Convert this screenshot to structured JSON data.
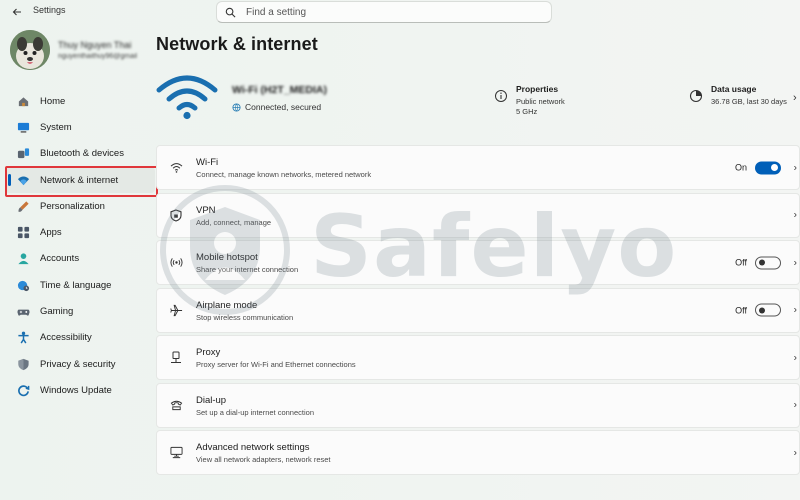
{
  "app": {
    "title": "Settings",
    "back_icon": "back-arrow-icon"
  },
  "search": {
    "placeholder": "Find a setting",
    "icon": "search-icon"
  },
  "profile": {
    "name": "Thuy Nguyen Thai",
    "email": "nguyenthaithuy96@gmail"
  },
  "sidebar": {
    "items": [
      {
        "label": "Home",
        "icon": "home-icon"
      },
      {
        "label": "System",
        "icon": "system-icon"
      },
      {
        "label": "Bluetooth & devices",
        "icon": "bluetooth-icon"
      },
      {
        "label": "Network & internet",
        "icon": "wifi-icon",
        "active": true
      },
      {
        "label": "Personalization",
        "icon": "brush-icon"
      },
      {
        "label": "Apps",
        "icon": "apps-icon"
      },
      {
        "label": "Accounts",
        "icon": "person-icon"
      },
      {
        "label": "Time & language",
        "icon": "globe-clock-icon"
      },
      {
        "label": "Gaming",
        "icon": "gamepad-icon"
      },
      {
        "label": "Accessibility",
        "icon": "accessibility-icon"
      },
      {
        "label": "Privacy & security",
        "icon": "shield-icon"
      },
      {
        "label": "Windows Update",
        "icon": "update-icon"
      }
    ]
  },
  "main": {
    "title": "Network & internet",
    "connection": {
      "name": "Wi-Fi (H2T_MEDIA)",
      "status": "Connected, secured"
    },
    "properties": {
      "title": "Properties",
      "line1": "Public network",
      "line2": "5 GHz"
    },
    "data_usage": {
      "title": "Data usage",
      "line1": "36.78 GB, last 30 days"
    },
    "rows": [
      {
        "title": "Wi-Fi",
        "desc": "Connect, manage known networks, metered network",
        "toggle": "On",
        "icon": "wifi-icon"
      },
      {
        "title": "VPN",
        "desc": "Add, connect, manage",
        "icon": "vpn-shield-icon"
      },
      {
        "title": "Mobile hotspot",
        "desc": "Share your internet connection",
        "toggle": "Off",
        "icon": "hotspot-icon"
      },
      {
        "title": "Airplane mode",
        "desc": "Stop wireless communication",
        "toggle": "Off",
        "icon": "airplane-icon"
      },
      {
        "title": "Proxy",
        "desc": "Proxy server for Wi-Fi and Ethernet connections",
        "icon": "proxy-icon"
      },
      {
        "title": "Dial-up",
        "desc": "Set up a dial-up internet connection",
        "icon": "dialup-icon"
      },
      {
        "title": "Advanced network settings",
        "desc": "View all network adapters, network reset",
        "icon": "network-adapter-icon"
      }
    ]
  },
  "watermark": {
    "text": "Safelyo"
  },
  "colors": {
    "accent": "#005fb8",
    "wifi_hero": "#1a6fb0",
    "highlight": "#e0373b"
  }
}
